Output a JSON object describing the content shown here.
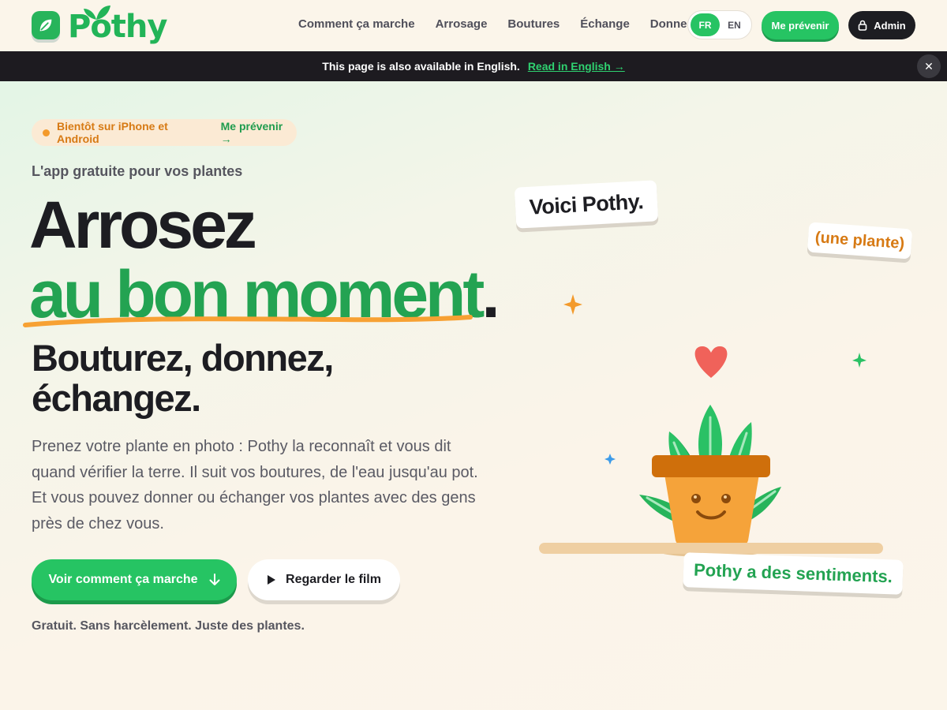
{
  "brand": {
    "name": "Pothy"
  },
  "nav": {
    "items": [
      "Comment ça marche",
      "Arrosage",
      "Boutures",
      "Échange",
      "Donner"
    ]
  },
  "language": {
    "options": [
      "FR",
      "EN"
    ],
    "active": "FR"
  },
  "header_buttons": {
    "notify": "Me prévenir",
    "admin": "Admin"
  },
  "banner": {
    "text": "This page is also available in English.",
    "link": "Read in English →",
    "close": "✕"
  },
  "hero": {
    "pill": {
      "text": "Bientôt sur iPhone et Android",
      "link": "Me prévenir →"
    },
    "kicker": "L'app gratuite pour vos plantes",
    "headline_1": "Arrosez",
    "headline_2": "au bon moment",
    "headline_2_dot": ".",
    "subheadline_1": "Bouturez, donnez,",
    "subheadline_2": "échangez.",
    "lead": "Prenez votre plante en photo : Pothy la reconnaît et vous dit quand vérifier la terre. Il suit vos boutures, de l'eau jusqu'au pot. Et vous pouvez donner ou échanger vos plantes avec des gens près de chez vous.",
    "primary_button": "Voir comment ça marche",
    "secondary_button": "Regarder le film",
    "tagline": "Gratuit. Sans harcèlement. Juste des plantes."
  },
  "illustration": {
    "sticker_1": "Voici Pothy.",
    "sticker_2": "(une plante)",
    "sticker_3": "Pothy a des sentiments."
  },
  "colors": {
    "brand_green": "#26c463",
    "heading_green": "#23a352",
    "accent_orange": "#f39a2b",
    "dark": "#1d1d22",
    "background": "#fbf5ea"
  }
}
